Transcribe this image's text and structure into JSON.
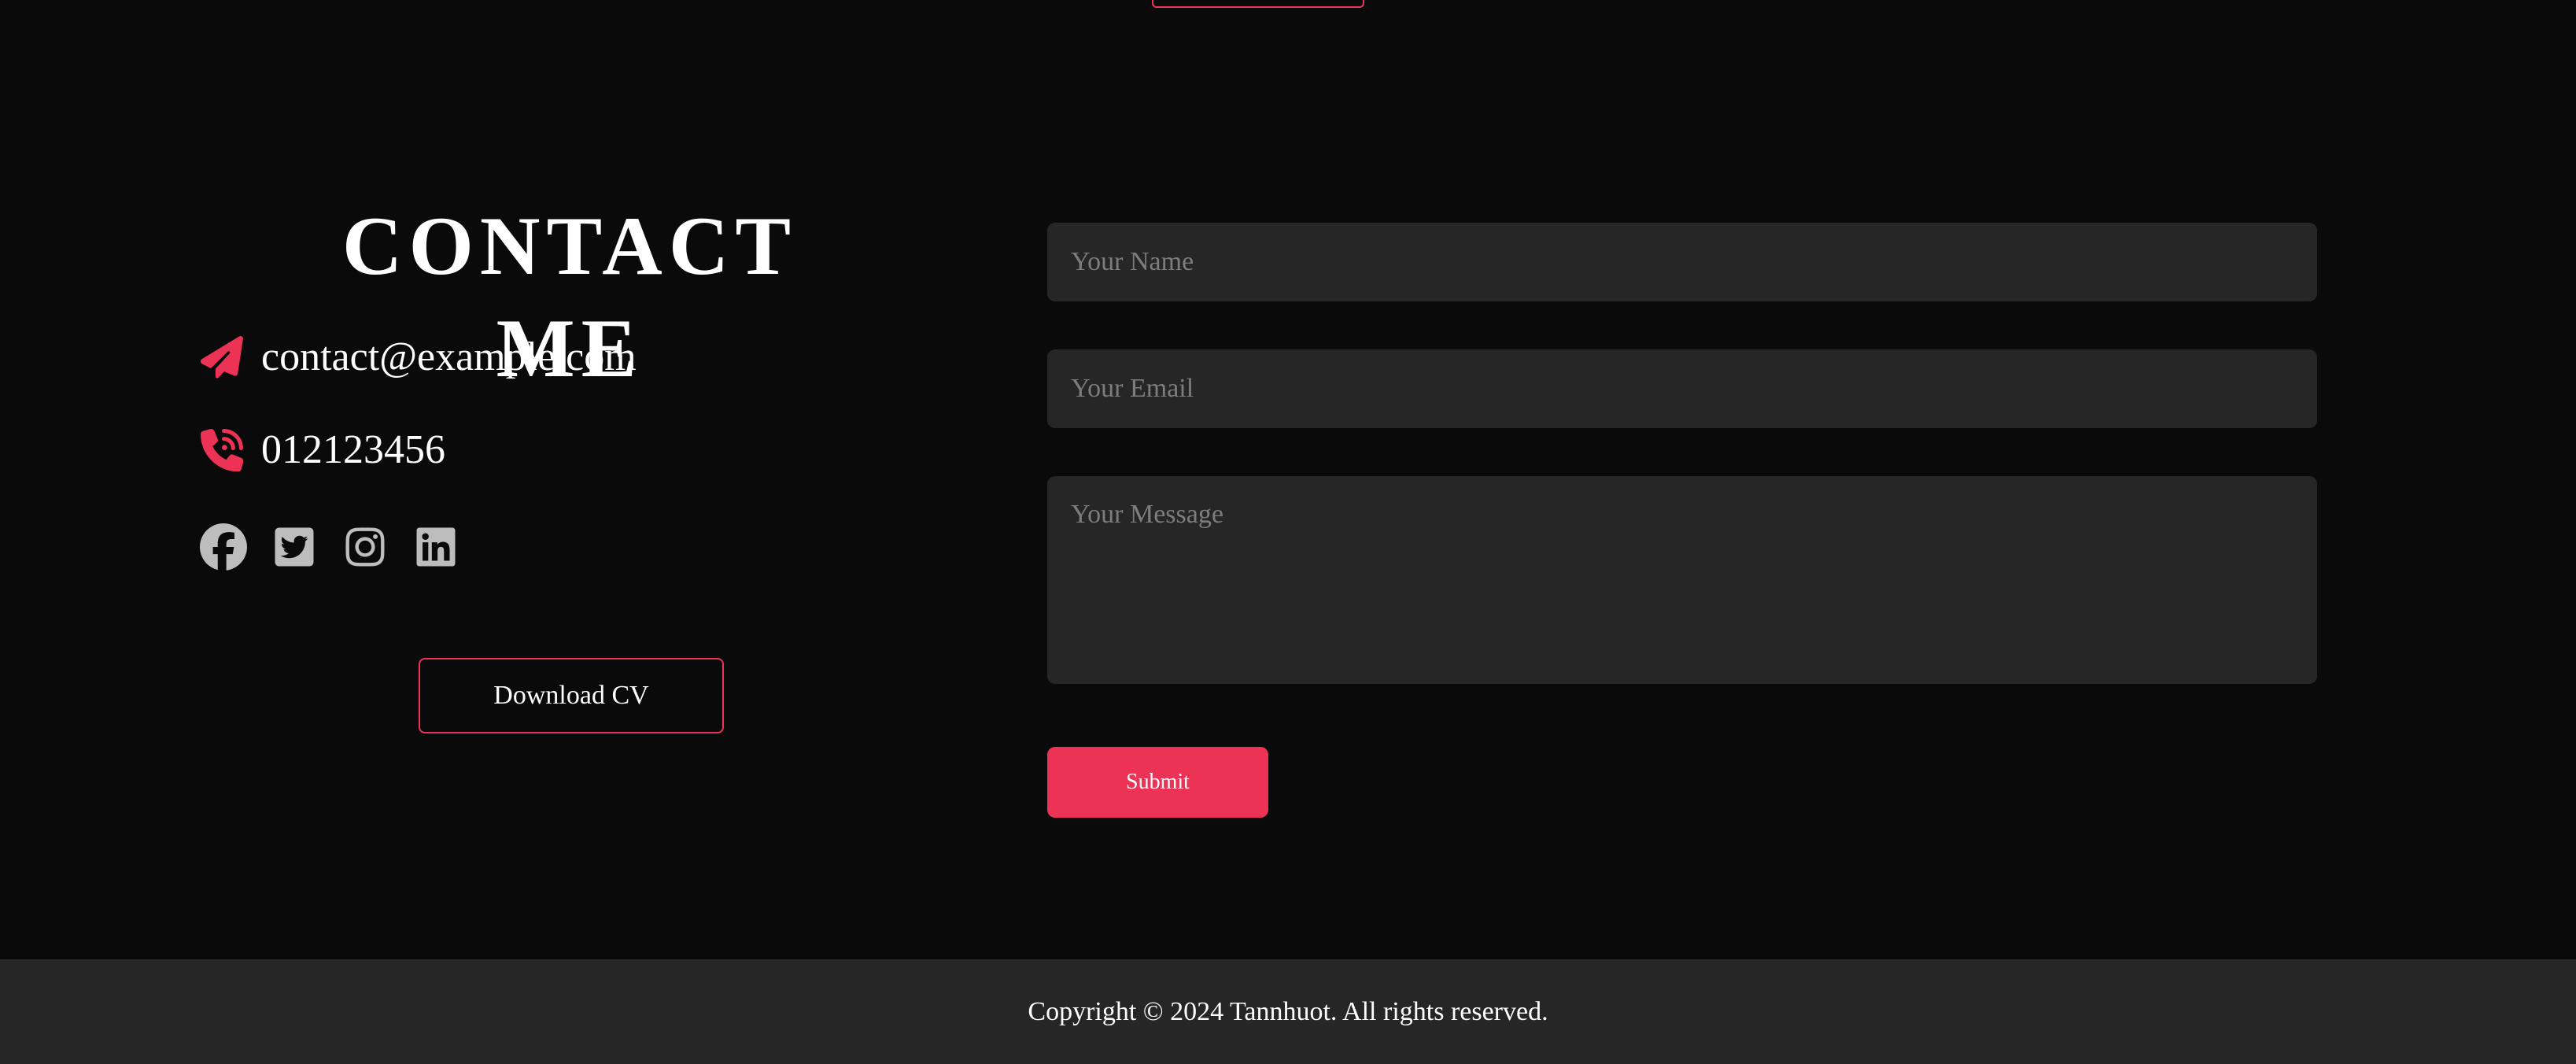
{
  "colors": {
    "background": "#0a0a0a",
    "accent": "#ec3356",
    "field_bg": "#262626",
    "social_icon": "#bdbdbd",
    "footer_bg": "#262626"
  },
  "contact": {
    "title": "CONTACT ME",
    "email": {
      "icon": "paper-plane-icon",
      "text": "contact@example.com"
    },
    "phone": {
      "icon": "phone-volume-icon",
      "text": "012123456"
    },
    "socials": [
      {
        "icon": "facebook-icon"
      },
      {
        "icon": "twitter-icon"
      },
      {
        "icon": "instagram-icon"
      },
      {
        "icon": "linkedin-icon"
      }
    ],
    "download_label": "Download CV"
  },
  "form": {
    "name_placeholder": "Your Name",
    "email_placeholder": "Your Email",
    "message_placeholder": "Your Message",
    "submit_label": "Submit"
  },
  "footer": {
    "copyright": "Copyright © 2024 Tannhuot. All rights reserved."
  }
}
